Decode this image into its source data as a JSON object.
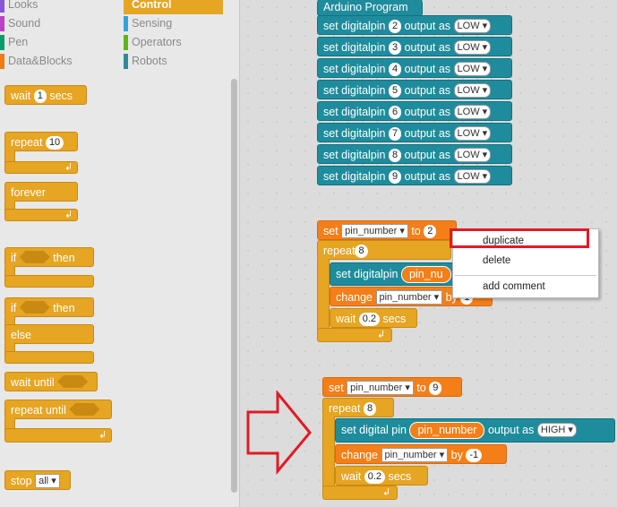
{
  "categories": [
    {
      "label": "Looks",
      "color": "#8a55d7"
    },
    {
      "label": "Control",
      "color": "#e6a522",
      "selected": true
    },
    {
      "label": "Sound",
      "color": "#bb42c3"
    },
    {
      "label": "Sensing",
      "color": "#2ca5e2"
    },
    {
      "label": "Pen",
      "color": "#0e9a6c"
    },
    {
      "label": "Operators",
      "color": "#5cb712"
    },
    {
      "label": "Data&Blocks",
      "color": "#ee7d16"
    },
    {
      "label": "Robots",
      "color": "#2b8a9c"
    }
  ],
  "palette": {
    "wait_label": "wait",
    "wait_value": "1",
    "wait_unit": "secs",
    "repeat_label": "repeat",
    "repeat_value": "10",
    "forever_label": "forever",
    "if_label": "if",
    "then_label": "then",
    "if2_label": "if",
    "then2_label": "then",
    "else_label": "else",
    "wait_until_label": "wait until",
    "repeat_until_label": "repeat until",
    "stop_label": "stop",
    "stop_value": "all"
  },
  "program": {
    "hat_label": "Arduino Program",
    "rows": [
      {
        "pin": "2",
        "state": "LOW"
      },
      {
        "pin": "3",
        "state": "LOW"
      },
      {
        "pin": "4",
        "state": "LOW"
      },
      {
        "pin": "5",
        "state": "LOW"
      },
      {
        "pin": "6",
        "state": "LOW"
      },
      {
        "pin": "7",
        "state": "LOW"
      },
      {
        "pin": "8",
        "state": "LOW"
      },
      {
        "pin": "9",
        "state": "LOW"
      }
    ],
    "set_digitalpin": "set digitalpin",
    "output_as": "output as"
  },
  "script1": {
    "set": "set",
    "var": "pin_number",
    "to": "to",
    "to_value": "2",
    "repeat": "repeat",
    "repeat_value": "8",
    "set_digitalpin": "set digitalpin",
    "var_reporter": "pin_nu",
    "change": "change",
    "change_var": "pin_number",
    "by": "by",
    "by_value": "1",
    "wait": "wait",
    "wait_value": "0.2",
    "secs": "secs"
  },
  "script2": {
    "set": "set",
    "var": "pin_number",
    "to": "to",
    "to_value": "9",
    "repeat": "repeat",
    "repeat_value": "8",
    "set_digital_pin": "set digital pin",
    "var_reporter": "pin_number",
    "output_as": "output as",
    "state": "HIGH",
    "change": "change",
    "change_var": "pin_number",
    "by": "by",
    "by_value": "-1",
    "wait": "wait",
    "wait_value": "0.2",
    "secs": "secs"
  },
  "context_menu": {
    "items": [
      "duplicate",
      "delete",
      "add comment"
    ]
  },
  "accent_colors": {
    "highlight": "#e01b24",
    "control": "#e6a522",
    "data": "#f47f18",
    "robots": "#1e8c9c"
  }
}
